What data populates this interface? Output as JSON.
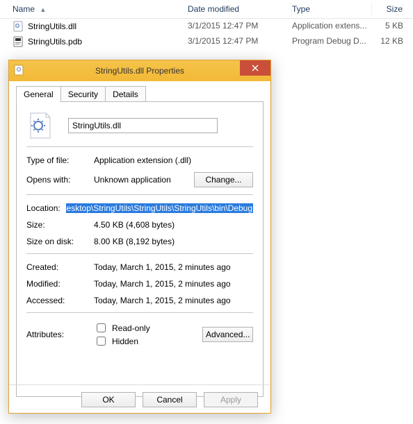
{
  "explorer": {
    "columns": {
      "name": "Name",
      "date": "Date modified",
      "type": "Type",
      "size": "Size"
    },
    "rows": [
      {
        "name": "StringUtils.dll",
        "date": "3/1/2015 12:47 PM",
        "type": "Application extens...",
        "size": "5 KB"
      },
      {
        "name": "StringUtils.pdb",
        "date": "3/1/2015 12:47 PM",
        "type": "Program Debug D...",
        "size": "12 KB"
      }
    ]
  },
  "dialog": {
    "title": "StringUtils.dll Properties",
    "tabs": {
      "general": "General",
      "security": "Security",
      "details": "Details"
    },
    "filename": "StringUtils.dll",
    "labels": {
      "type_of_file": "Type of file:",
      "opens_with": "Opens with:",
      "location": "Location:",
      "size": "Size:",
      "size_on_disk": "Size on disk:",
      "created": "Created:",
      "modified": "Modified:",
      "accessed": "Accessed:",
      "attributes": "Attributes:"
    },
    "values": {
      "type_of_file": "Application extension (.dll)",
      "opens_with": "Unknown application",
      "location": "esktop\\StringUtils\\StringUtils\\StringUtils\\bin\\Debug",
      "size": "4.50 KB (4,608 bytes)",
      "size_on_disk": "8.00 KB (8,192 bytes)",
      "created": "Today, March 1, 2015, 2 minutes ago",
      "modified": "Today, March 1, 2015, 2 minutes ago",
      "accessed": "Today, March 1, 2015, 2 minutes ago"
    },
    "buttons": {
      "change": "Change...",
      "advanced": "Advanced...",
      "ok": "OK",
      "cancel": "Cancel",
      "apply": "Apply"
    },
    "checkboxes": {
      "readonly": "Read-only",
      "hidden": "Hidden"
    }
  }
}
